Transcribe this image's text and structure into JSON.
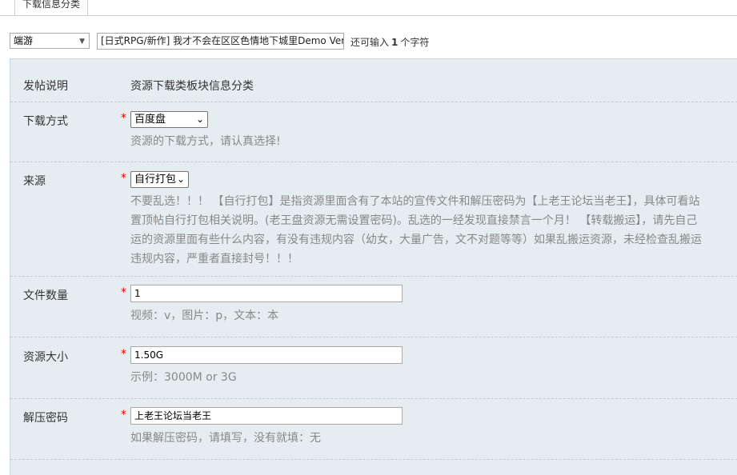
{
  "tab": {
    "label": "下载信息分类"
  },
  "header": {
    "category_select": "端游",
    "title_value": "[日式RPG/新作] 我才不会在区区色情地下城里Demo Ver",
    "remaining_prefix": "还可输入",
    "remaining_count": "1",
    "remaining_suffix": "个字符"
  },
  "form": {
    "intro": {
      "label": "发帖说明",
      "value": "资源下载类板块信息分类"
    },
    "download_method": {
      "label": "下载方式",
      "required": "*",
      "selected": "百度盘",
      "hint": "资源的下载方式，请认真选择!"
    },
    "source": {
      "label": "来源",
      "required": "*",
      "selected": "自行打包",
      "hint_lines": [
        "不要乱选！！！  【自行打包】是指资源里面含有了本站的宣传文件和解压密码为【上老王论坛当老王】，具体可看站",
        "置顶帖自行打包相关说明。(老王盘资源无需设置密码)。乱选的一经发现直接禁言一个月！ 【转载搬运】，请先自己",
        "运的资源里面有些什么内容，有没有违规内容（幼女，大量广告，文不对题等等）如果乱搬运资源，未经检查乱搬运",
        "违规内容，严重者直接封号！！！"
      ]
    },
    "file_count": {
      "label": "文件数量",
      "required": "*",
      "value": "1",
      "hint": "视频：v，图片：p，文本：本"
    },
    "size": {
      "label": "资源大小",
      "required": "*",
      "value": "1.50G",
      "hint": "示例：3000M or 3G"
    },
    "password": {
      "label": "解压密码",
      "required": "*",
      "value": "上老王论坛当老王",
      "hint": "如果解压密码，请填写，没有就填：无"
    }
  }
}
